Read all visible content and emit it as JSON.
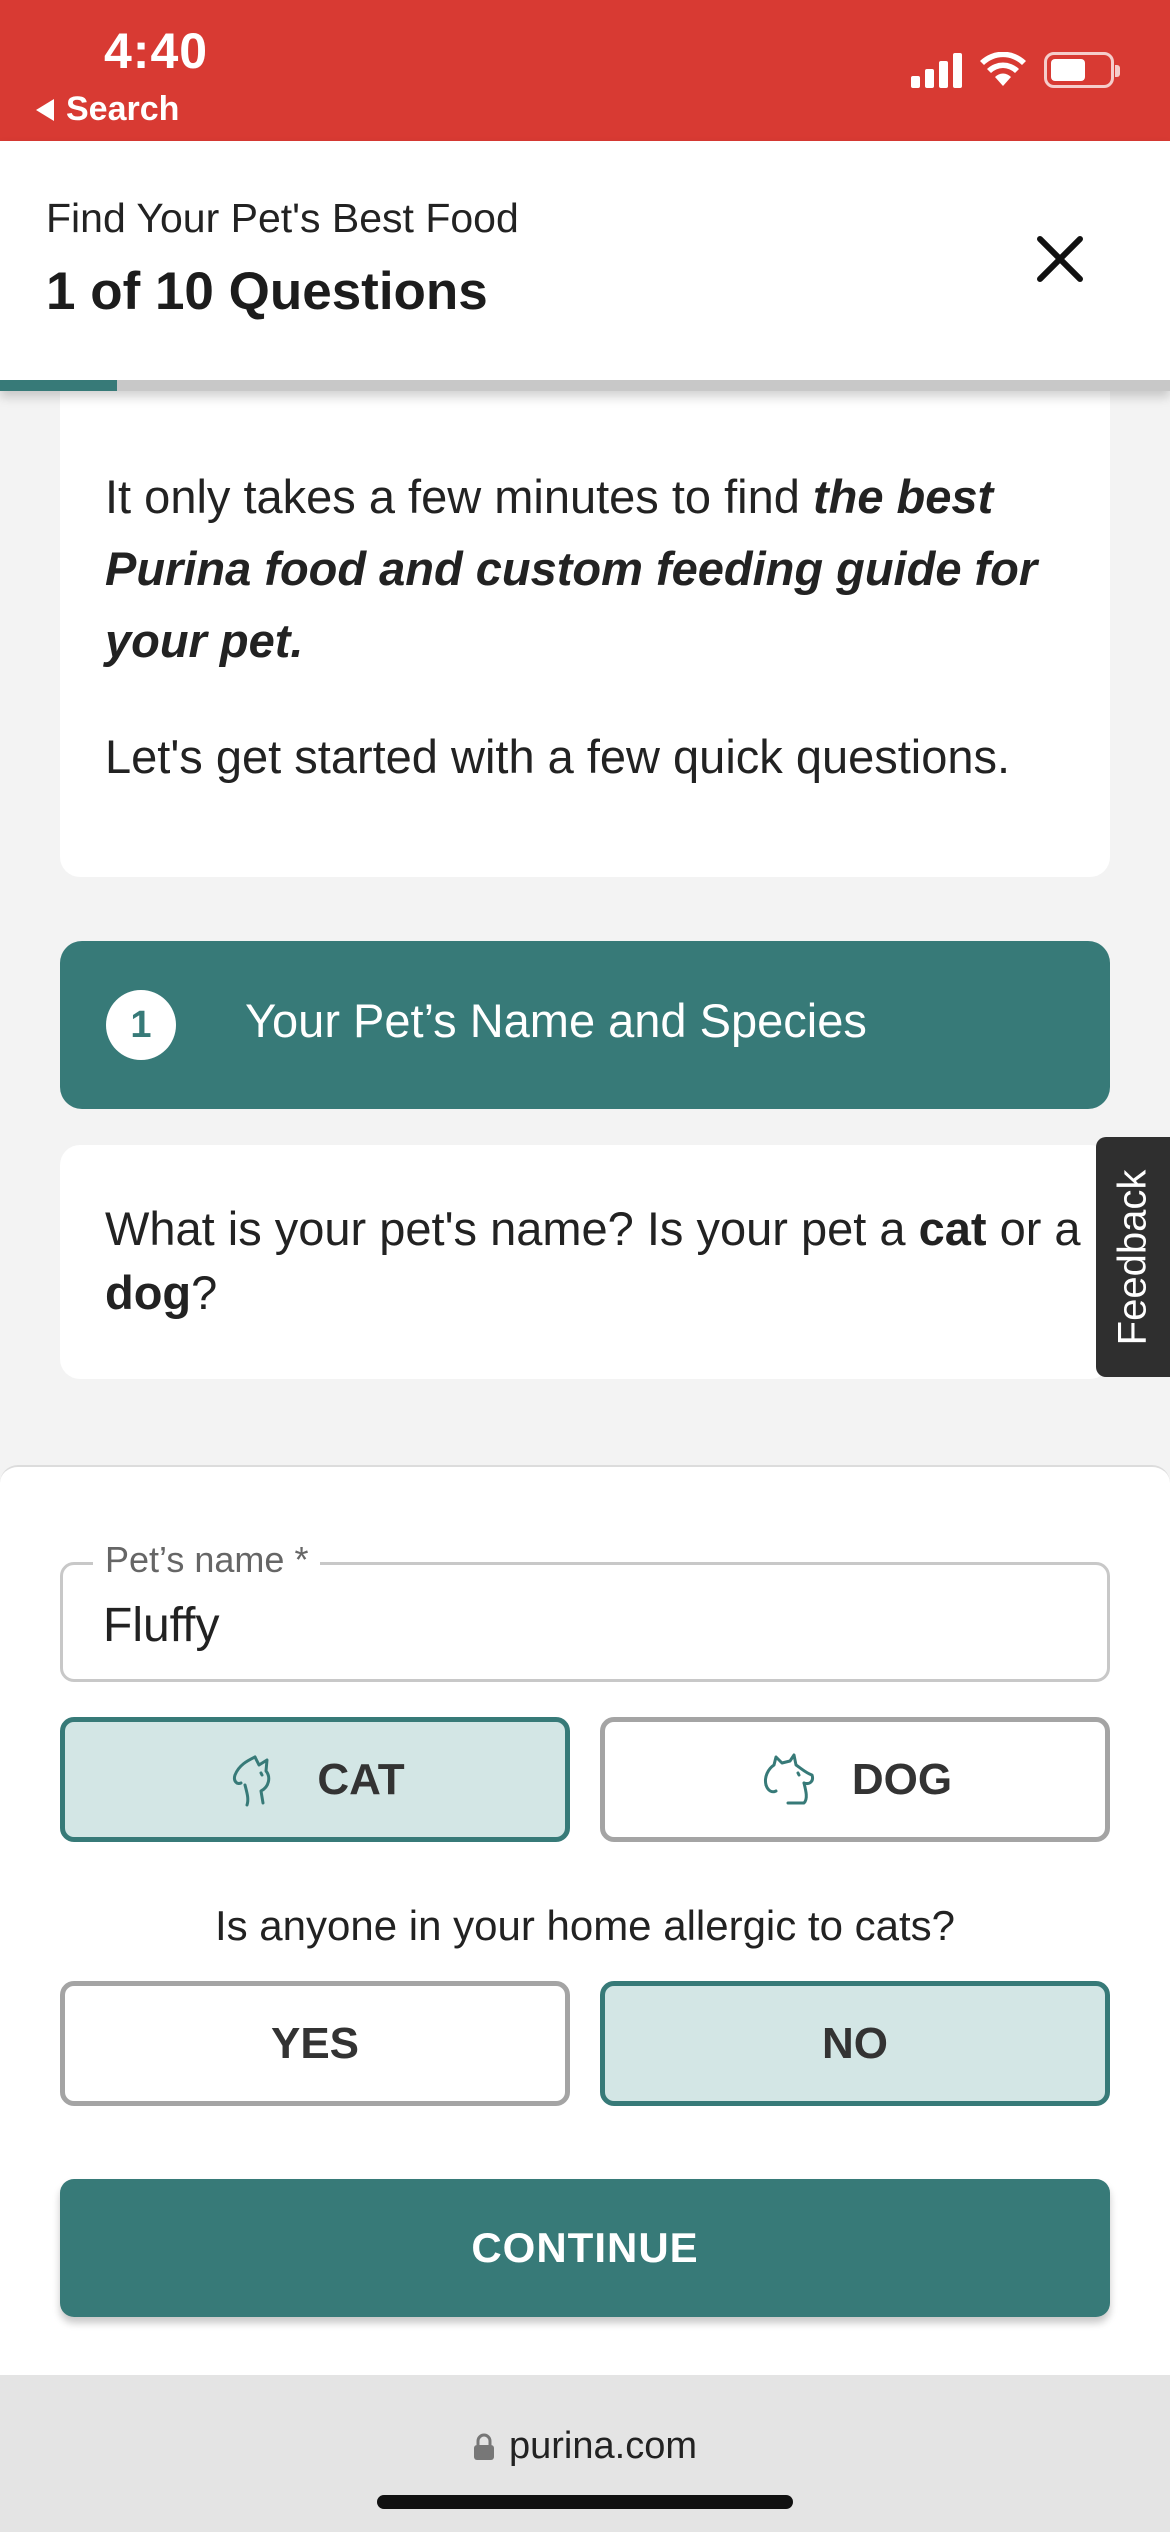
{
  "status_bar": {
    "time": "4:40",
    "back_label": "Search"
  },
  "header": {
    "subtitle": "Find Your Pet's Best Food",
    "title": "1 of 10 Questions",
    "progress": 0.1
  },
  "intro": {
    "p1_plain": "It only takes a few minutes to find ",
    "p1_bold": "the best Purina food and custom feeding guide for your pet.",
    "p2": "Let's get started with a few quick questions."
  },
  "section": {
    "step": "1",
    "title": "Your Pet’s Name and Species"
  },
  "question": {
    "part1": "What is your pet's name? Is your pet a ",
    "cat": "cat",
    "part2": " or a ",
    "dog": "dog",
    "part3": "?"
  },
  "feedback_label": "Feedback",
  "form": {
    "name_label": "Pet’s name *",
    "name_value": "Fluffy",
    "cat_label": "CAT",
    "dog_label": "DOG",
    "allergy_question": "Is anyone in your home allergic to cats?",
    "yes_label": "YES",
    "no_label": "NO",
    "continue_label": "CONTINUE",
    "selected_species": "CAT",
    "selected_allergy": "NO"
  },
  "browser": {
    "url": "purina.com"
  },
  "colors": {
    "status_bar": "#d83a33",
    "accent": "#377a78",
    "selected_fill": "#d3e6e5"
  },
  "icons": {
    "close": "close-icon",
    "cat": "cat-icon",
    "dog": "dog-icon",
    "lock": "lock-icon"
  }
}
